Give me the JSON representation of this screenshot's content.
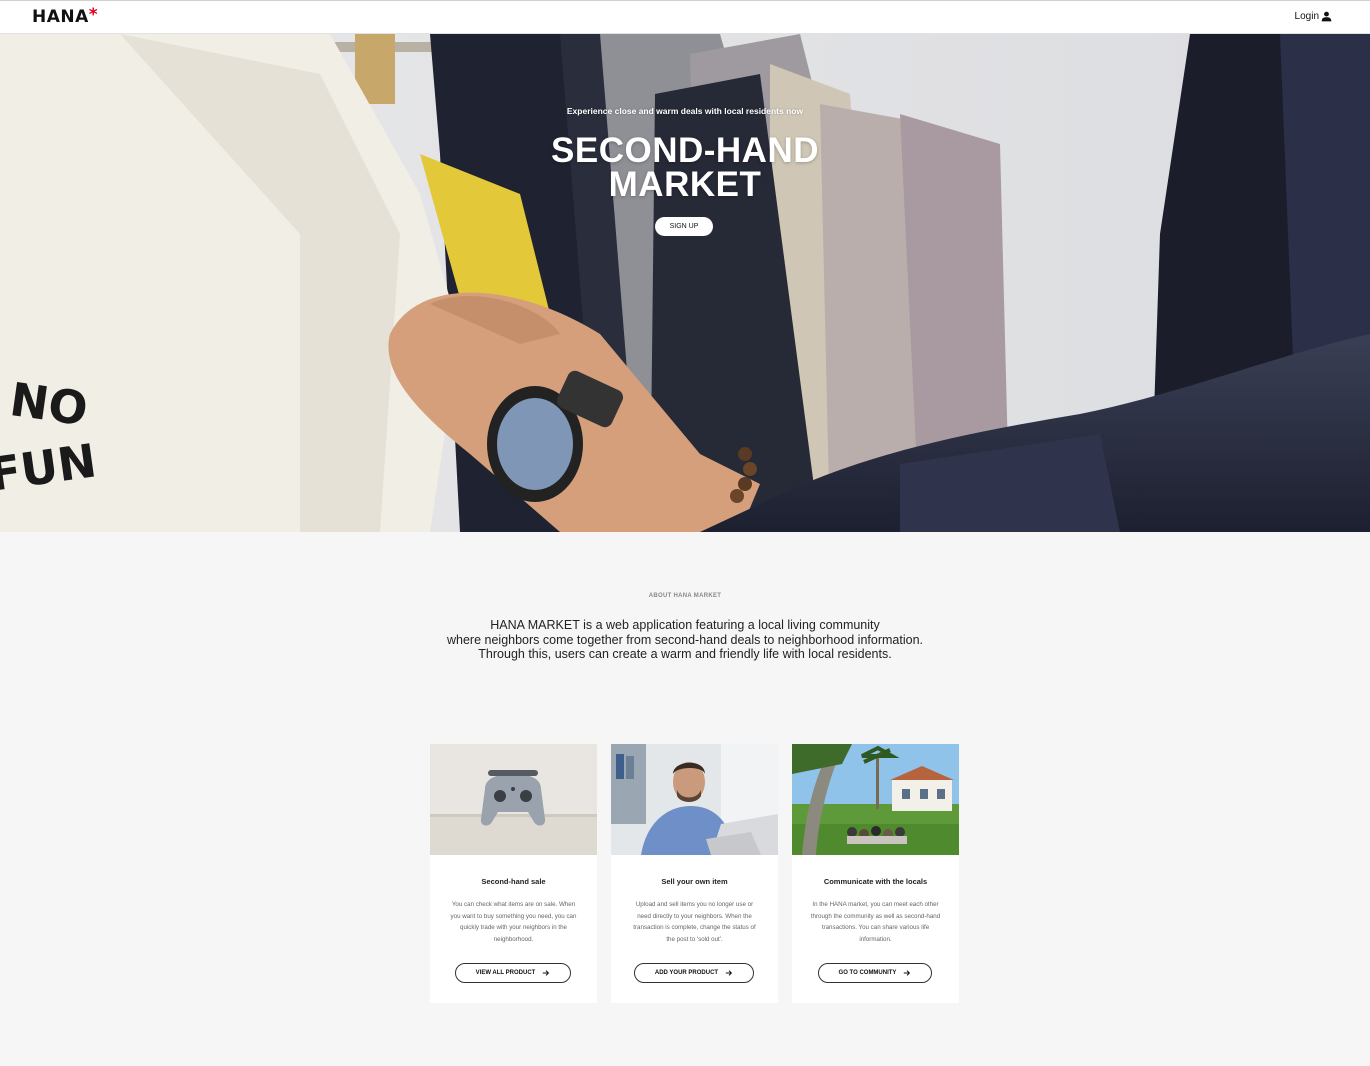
{
  "header": {
    "logo": "HANA",
    "logo_mark": "*",
    "login_label": "Login",
    "login_icon": "user-icon"
  },
  "hero": {
    "subtitle": "Experience close and warm deals with local residents now",
    "title_line1": "SECOND-HAND",
    "title_line2": "MARKET",
    "signup_label": "SIGN UP",
    "shirt_text_line1": "NO",
    "shirt_text_line2": "FUN"
  },
  "about": {
    "label": "ABOUT HANA MARKET",
    "line1": "HANA MARKET is a web application featuring a local living community",
    "line2": "where neighbors come together from second-hand deals to neighborhood information.",
    "line3": "Through this, users can create a warm and friendly life with local residents."
  },
  "cards": [
    {
      "title": "Second-hand sale",
      "description": "You can check what items are on sale. When you want to buy something you need, you can quickly trade with your neighbors in the neighborhood.",
      "button_label": "VIEW ALL PRODUCT",
      "button_icon": "arrow-right-icon"
    },
    {
      "title": "Sell your own item",
      "description": "Upload and sell items you no longer use or need directly to your neighbors. When the transaction is complete, change the status of the post to 'sold out'.",
      "button_label": "ADD YOUR PRODUCT",
      "button_icon": "arrow-right-icon"
    },
    {
      "title": "Communicate with the locals",
      "description": "In the HANA market, you can meet each other through the community as well as second-hand transactions. You can share various life information.",
      "button_label": "GO TO COMMUNITY",
      "button_icon": "arrow-right-icon"
    }
  ],
  "colors": {
    "accent": "#e0001b",
    "background": "#f6f6f6",
    "text": "#222222"
  }
}
